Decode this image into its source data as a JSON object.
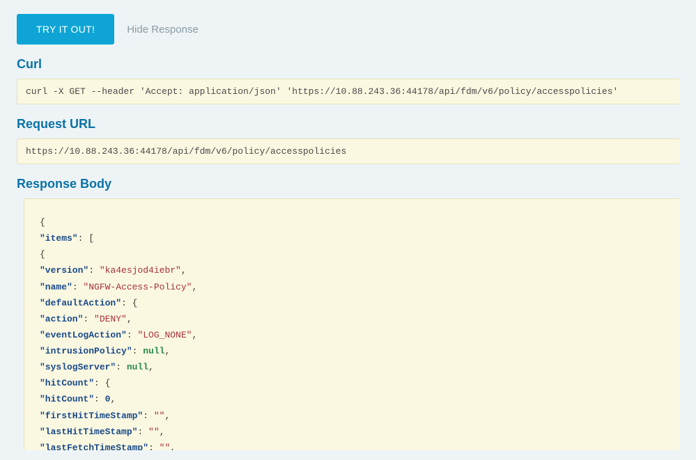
{
  "top": {
    "try_button_label": "TRY IT OUT!",
    "hide_response_label": "Hide Response"
  },
  "sections": {
    "curl_header": "Curl",
    "curl_value": "curl -X GET --header 'Accept: application/json' 'https://10.88.243.36:44178/api/fdm/v6/policy/accesspolicies'",
    "request_url_header": "Request URL",
    "request_url_value": "https://10.88.243.36:44178/api/fdm/v6/policy/accesspolicies",
    "response_body_header": "Response Body"
  },
  "response_json": {
    "items": [
      {
        "version": "ka4esjod4iebr",
        "name": "NGFW-Access-Policy",
        "defaultAction": {
          "action": "DENY",
          "eventLogAction": "LOG_NONE",
          "intrusionPolicy": null,
          "syslogServer": null,
          "hitCount": {
            "hitCount": 0,
            "firstHitTimeStamp": "",
            "lastHitTimeStamp": "",
            "lastFetchTimeStamp": ""
          }
        }
      }
    ]
  }
}
